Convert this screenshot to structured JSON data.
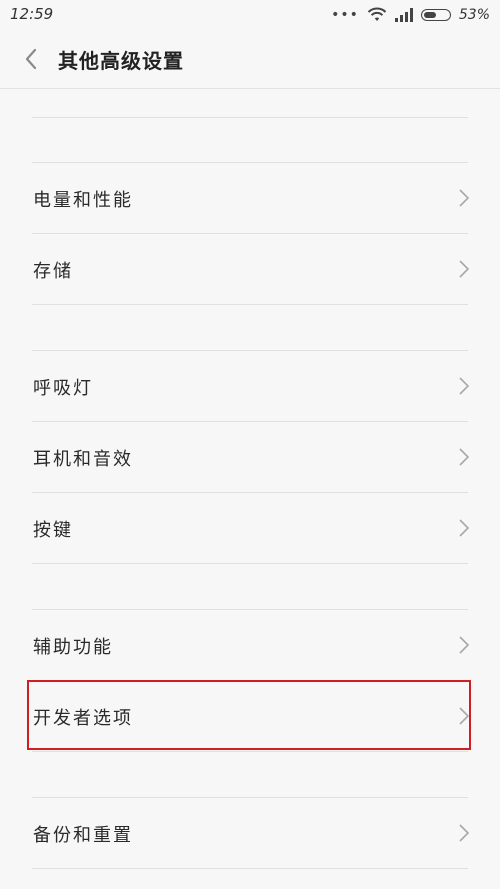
{
  "status_bar": {
    "time": "12:59",
    "signal_dots": "•••",
    "battery_percent": "53%",
    "battery_level": 0.53
  },
  "header": {
    "title": "其他高级设置"
  },
  "settings": {
    "power": "电量和性能",
    "storage": "存储",
    "breathing_light": "呼吸灯",
    "headphones_audio": "耳机和音效",
    "buttons": "按键",
    "accessibility": "辅助功能",
    "developer_options": "开发者选项",
    "backup_reset": "备份和重置"
  },
  "colors": {
    "highlight_border": "#d11f1f",
    "background": "#f7f7f7"
  }
}
